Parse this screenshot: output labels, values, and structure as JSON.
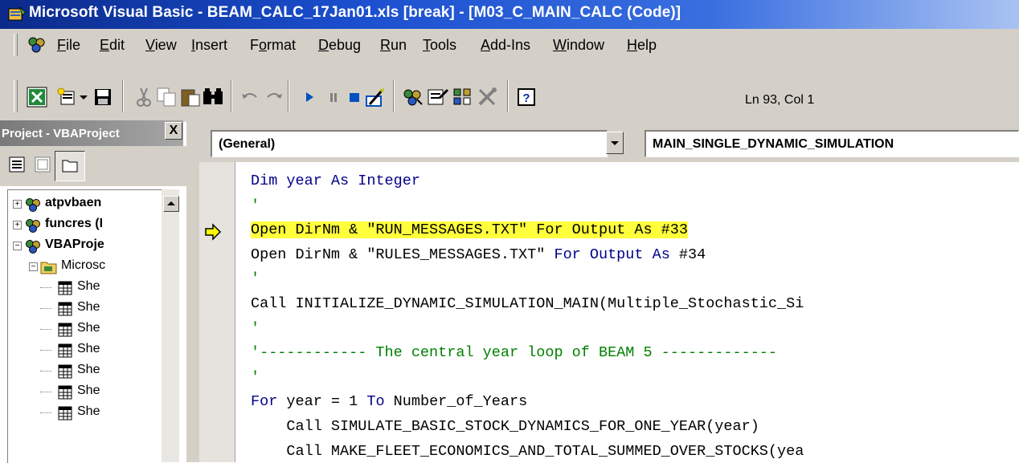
{
  "window": {
    "title": "Microsoft Visual Basic - BEAM_CALC_17Jan01.xls [break] - [M03_C_MAIN_CALC (Code)]"
  },
  "menu": [
    {
      "key": "F",
      "rest": "ile"
    },
    {
      "key": "E",
      "rest": "dit"
    },
    {
      "key": "V",
      "rest": "iew"
    },
    {
      "key": "I",
      "rest": "nsert"
    },
    {
      "key": "F",
      "rest": "o",
      "rest2": "rmat",
      "pre": "F",
      "mid": "o"
    },
    {
      "key": "D",
      "rest": "ebug"
    },
    {
      "key": "R",
      "rest": "un"
    },
    {
      "key": "T",
      "rest": "ools"
    },
    {
      "key": "A",
      "rest": "dd-Ins"
    },
    {
      "key": "W",
      "rest": "indow"
    },
    {
      "key": "H",
      "rest": "elp"
    }
  ],
  "menu_labels": [
    "File",
    "Edit",
    "View",
    "Insert",
    "Format",
    "Debug",
    "Run",
    "Tools",
    "Add-Ins",
    "Window",
    "Help"
  ],
  "toolbar": {
    "position_text": "Ln 93, Col 1",
    "icons": [
      "excel-icon",
      "insert-module-icon",
      "dropdown-arrow-icon",
      "save-icon",
      "cut-icon",
      "copy-icon",
      "paste-icon",
      "find-icon",
      "undo-icon",
      "redo-icon",
      "run-icon",
      "break-icon",
      "reset-icon",
      "design-mode-icon",
      "project-explorer-icon",
      "properties-icon",
      "object-browser-icon",
      "toolbox-icon",
      "help-icon"
    ]
  },
  "project": {
    "title": "Project - VBAProject",
    "close_glyph": "X",
    "tree": [
      {
        "label": "atpvbaen",
        "bold": true,
        "expander": "+"
      },
      {
        "label": "funcres (I",
        "bold": true,
        "expander": "+"
      },
      {
        "label": "VBAProje",
        "bold": true,
        "expander": "-"
      },
      {
        "label": "Microsc",
        "bold": false,
        "expander": "-"
      },
      {
        "label": "She",
        "bold": false
      },
      {
        "label": "She",
        "bold": false
      },
      {
        "label": "She",
        "bold": false
      },
      {
        "label": "She",
        "bold": false
      },
      {
        "label": "She",
        "bold": false
      },
      {
        "label": "She",
        "bold": false
      },
      {
        "label": "She",
        "bold": false
      }
    ]
  },
  "code_header": {
    "object_combo": "(General)",
    "procedure_combo": "MAIN_SINGLE_DYNAMIC_SIMULATION"
  },
  "code": [
    {
      "segments": [
        {
          "t": "Dim year ",
          "c": "kw"
        },
        {
          "t": "As ",
          "c": "kw"
        },
        {
          "t": "Integer",
          "c": "kw"
        }
      ]
    },
    {
      "segments": [
        {
          "t": "'",
          "c": "cm"
        }
      ]
    },
    {
      "highlight": true,
      "segments": [
        {
          "t": "Open DirNm & \"RUN_MESSAGES.TXT\" For Output As #33",
          "c": ""
        }
      ]
    },
    {
      "segments": [
        {
          "t": "Open DirNm & \"RULES_MESSAGES.TXT\" ",
          "c": ""
        },
        {
          "t": "For Output As ",
          "c": "kw"
        },
        {
          "t": "#34",
          "c": ""
        }
      ]
    },
    {
      "segments": [
        {
          "t": "'",
          "c": "cm"
        }
      ]
    },
    {
      "segments": [
        {
          "t": "Call INITIALIZE_DYNAMIC_SIMULATION_MAIN(Multiple_Stochastic_Si",
          "c": ""
        }
      ]
    },
    {
      "segments": [
        {
          "t": "'",
          "c": "cm"
        }
      ]
    },
    {
      "segments": [
        {
          "t": "'------------ The central year loop of BEAM 5 -------------",
          "c": "cm"
        }
      ]
    },
    {
      "segments": [
        {
          "t": "'",
          "c": "cm"
        }
      ]
    },
    {
      "segments": [
        {
          "t": "For ",
          "c": "kw"
        },
        {
          "t": "year = 1 ",
          "c": ""
        },
        {
          "t": "To ",
          "c": "kw"
        },
        {
          "t": "Number_of_Years",
          "c": ""
        }
      ]
    },
    {
      "segments": [
        {
          "t": "    Call SIMULATE_BASIC_STOCK_DYNAMICS_FOR_ONE_YEAR(year)",
          "c": ""
        }
      ]
    },
    {
      "segments": [
        {
          "t": "    Call MAKE_FLEET_ECONOMICS_AND_TOTAL_SUMMED_OVER_STOCKS(yea",
          "c": ""
        }
      ]
    }
  ],
  "colors": {
    "keyword": "#00008b",
    "comment": "#008000",
    "highlight": "#ffff3c",
    "titlebar": "#1b4fcf"
  }
}
